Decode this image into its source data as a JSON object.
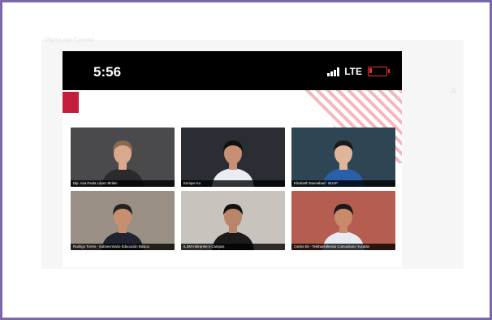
{
  "background": {
    "caption": "Pleno del Comité",
    "right_text": "A"
  },
  "phone": {
    "status": {
      "time": "5:56",
      "network": "LTE",
      "battery_color": "#e33333"
    },
    "accent_color": "#c41e3a"
  },
  "tiles": [
    {
      "name": "Dip. Ana Paola López Birlain",
      "bg": "#4a4a4c",
      "skin": "#d9a98d",
      "hair": "#8a6a4e",
      "shirt": "#2b2b2b"
    },
    {
      "name": "Enrique Ku",
      "bg": "#2a2d33",
      "skin": "#c98f72",
      "hair": "#111111",
      "shirt": "#e9edf2"
    },
    {
      "name": "Elizabeth Buenabad - BUAP",
      "bg": "#2e4654",
      "skin": "#e1b59c",
      "hair": "#1a1a1a",
      "shirt": "#2b5fa8"
    },
    {
      "name": "Rodrigo Torres - Subsecretario Educación Básica",
      "bg": "#9a8f84",
      "skin": "#c78f70",
      "hair": "#222222",
      "shirt": "#1f2430"
    },
    {
      "name": "ILSM Intérprete II Campus",
      "bg": "#c8c4bd",
      "skin": "#b98468",
      "hair": "#111111",
      "shirt": "#1b1b1b"
    },
    {
      "name": "Carlos Ek - Telebachillerato Comunitario Yucatán",
      "bg": "#b45d50",
      "skin": "#c98a6c",
      "hair": "#1a1a1a",
      "shirt": "#e8ecf0"
    }
  ]
}
